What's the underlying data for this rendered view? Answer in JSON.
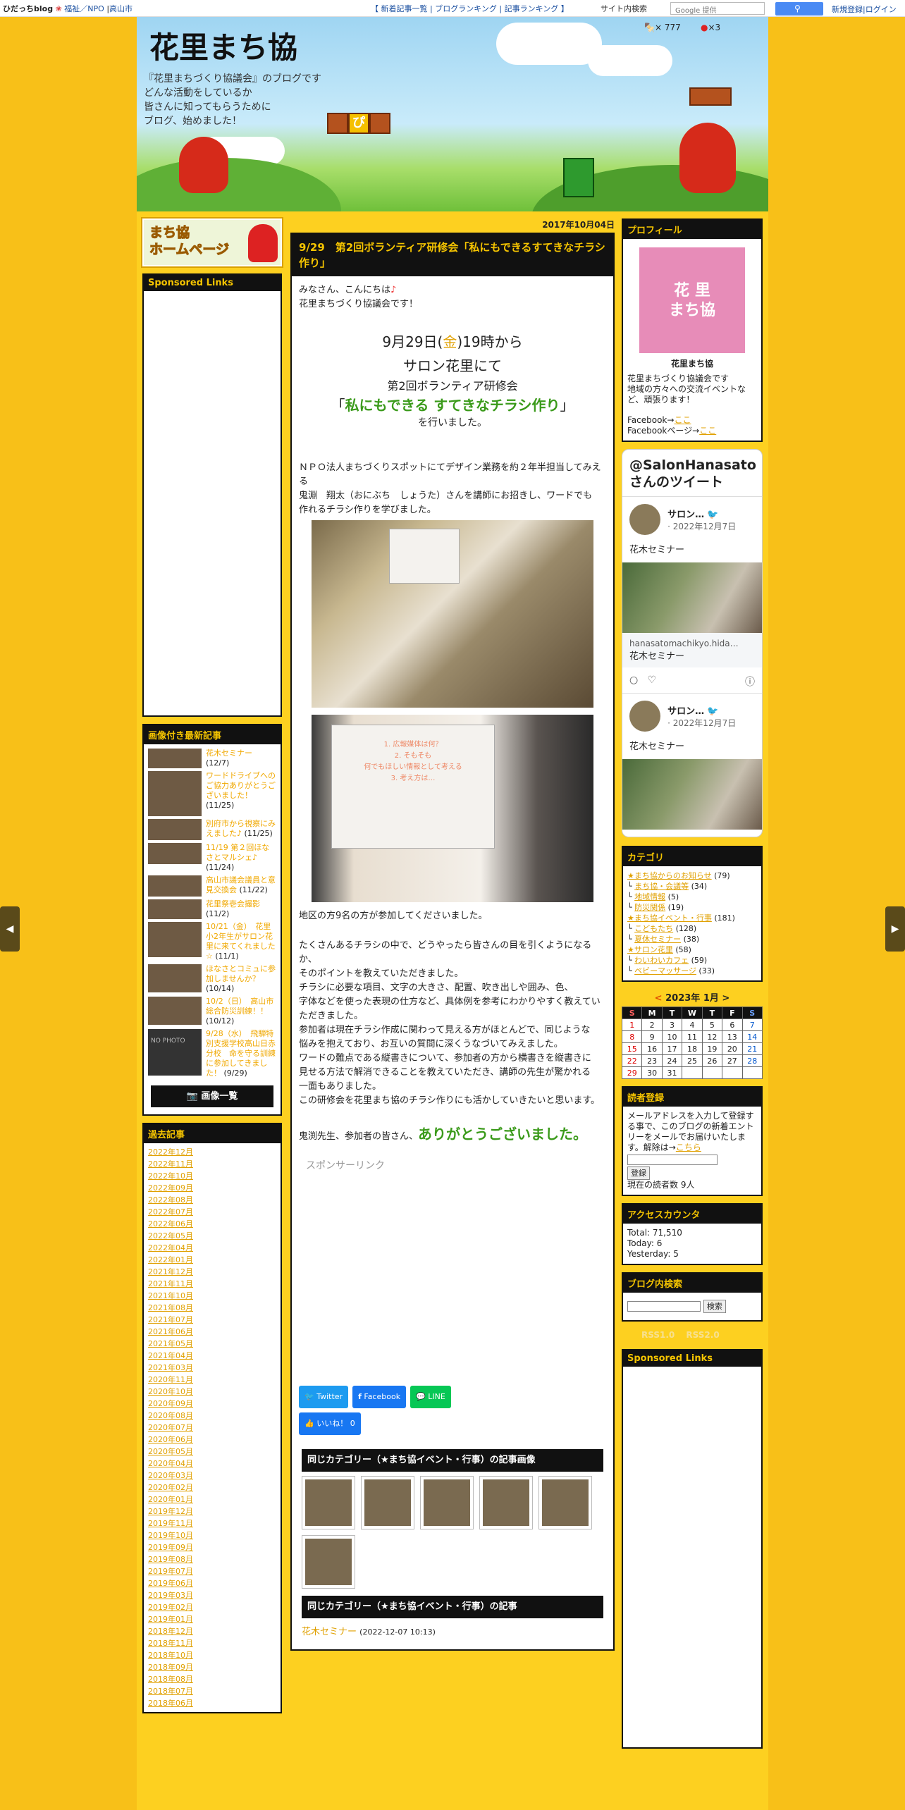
{
  "topbar": {
    "brand": "ひだっちblog",
    "cat1": "福祉／NPO",
    "cat2": "高山市",
    "links": [
      "新着記事一覧",
      "ブログランキング",
      "記事ランキング"
    ],
    "site_search": "サイト内検索",
    "google_placeholder": "Google 提供",
    "account": "新規登録|ログイン"
  },
  "header": {
    "title": "花里まち協",
    "desc": [
      "『花里まちづくり協議会』のブログです",
      "どんな活動をしているか",
      "皆さんに知ってもらうために",
      "ブログ、始めました！"
    ],
    "count1": "× 777",
    "count2": "×3",
    "block_letter": "ぴ"
  },
  "left": {
    "banner": [
      "まち協",
      "ホームページ"
    ],
    "sponsored_title": "Sponsored Links",
    "recent_title": "画像付き最新記事",
    "recent": [
      {
        "title": "花木セミナー",
        "date": "(12/7)"
      },
      {
        "title": "ワードドライブへのご協力ありがとうございました！",
        "date": "(11/25)"
      },
      {
        "title": "別府市から視察にみえました♪",
        "date": "(11/25)"
      },
      {
        "title": "11/19 第２回ほなさとマルシェ♪",
        "date": "(11/24)"
      },
      {
        "title": "高山市議会議員と意見交換会",
        "date": "(11/22)"
      },
      {
        "title": "花里祭壱会撮影",
        "date": "(11/2)"
      },
      {
        "title": "10/21（金）　花里小2年生がサロン花里に来てくれました☆",
        "date": "(11/1)"
      },
      {
        "title": "ほなさとコミュに参加しませんか？",
        "date": "(10/14)"
      },
      {
        "title": "10/2（日）　高山市総合防災訓練！！",
        "date": "(10/12)"
      },
      {
        "title": "9/28（水）　飛騨特別支援学校高山日赤分校　命を守る訓練に参加してきました！",
        "date": "(9/29)"
      }
    ],
    "no_photo": "NO PHOTO",
    "gallery_btn": "📷 画像一覧",
    "archive_title": "過去記事",
    "archive": [
      "2022年12月",
      "2022年11月",
      "2022年10月",
      "2022年09月",
      "2022年08月",
      "2022年07月",
      "2022年06月",
      "2022年05月",
      "2022年04月",
      "2022年01月",
      "2021年12月",
      "2021年11月",
      "2021年10月",
      "2021年08月",
      "2021年07月",
      "2021年06月",
      "2021年05月",
      "2021年04月",
      "2021年03月",
      "2020年11月",
      "2020年10月",
      "2020年09月",
      "2020年08月",
      "2020年07月",
      "2020年06月",
      "2020年05月",
      "2020年04月",
      "2020年03月",
      "2020年02月",
      "2020年01月",
      "2019年12月",
      "2019年11月",
      "2019年10月",
      "2019年09月",
      "2019年08月",
      "2019年07月",
      "2019年06月",
      "2019年03月",
      "2019年02月",
      "2019年01月",
      "2018年12月",
      "2018年11月",
      "2018年10月",
      "2018年09月",
      "2018年08月",
      "2018年07月",
      "2018年06月"
    ]
  },
  "post": {
    "date": "2017年10月04日",
    "title": "9/29　第2回ボランティア研修会「私にもできるすてきなチラシ作り」",
    "intro": [
      "みなさん、こんにちは",
      "花里まちづくり協議会です！"
    ],
    "heart": "♪",
    "when_pre": "9月29日(",
    "when_day": "金",
    "when_post": ")19時から",
    "where": "サロン花里にて",
    "event": "第2回ボランティア研修会",
    "theme_open": "「",
    "theme": "私にもできる すてきなチラシ作り",
    "theme_close": "」",
    "done": "を行いました。",
    "p1": [
      "ＮＰＯ法人まちづくりスポットにてデザイン業務を約２年半担当してみえる",
      "鬼淵　翔太（おにぶち　しょうた）さんを講師にお招きし、ワードでも",
      "作れるチラシ作りを学びました。"
    ],
    "slide_lines": [
      "1. 広報媒体は何？",
      "2. そもそも",
      "何でもほしい情報として考える",
      "3. 考え方は…"
    ],
    "attend": "地区の方9名の方が参加してくださいました。",
    "p2": [
      "たくさんあるチラシの中で、どうやったら皆さんの目を引くようになるか、",
      "そのポイントを教えていただきました。",
      "チラシに必要な項目、文字の大きさ、配置、吹き出しや囲み、色、",
      "字体などを使った表現の仕方など、具体例を参考にわかりやすく教えていただきました。",
      "参加者は現在チラシ作成に関わって見える方がほとんどで、同じような",
      "悩みを抱えており、お互いの質問に深くうなづいてみえました。",
      "ワードの難点である縦書きについて、参加者の方から横書きを縦書きに",
      "見せる方法で解消できることを教えていただき、講師の先生が驚かれる",
      "一面もありました。",
      "この研修会を花里まち協のチラシ作りにも活かしていきたいと思います。"
    ],
    "thanks_pre": "鬼渕先生、参加者の皆さん、",
    "thanks": "ありがとうございました。",
    "sponsor": "スポンサーリンク",
    "share": {
      "twitter": "Twitter",
      "facebook": "Facebook",
      "line": "LINE",
      "like": "いいね！ 0"
    },
    "same_cat_images_title": "同じカテゴリー（★まち協イベント・行事）の記事画像",
    "same_cat_title": "同じカテゴリー（★まち協イベント・行事）の記事",
    "same_cat_first": {
      "title": "花木セミナー",
      "date": "(2022-12-07 10:13)"
    }
  },
  "right": {
    "profile_title": "プロフィール",
    "logo": [
      "花 里",
      "まち協"
    ],
    "name": "花里まち協",
    "profile_text": [
      "花里まちづくり協議会です",
      "地域の方々への交流イベントなど、頑張ります！"
    ],
    "fb1_pre": "Facebook→",
    "fb1_link": "ここ",
    "fb2_pre": "Facebookページ→",
    "fb2_link": "ここ",
    "twitter_title": "@SalonHanasato さんのツイート",
    "tweets": [
      {
        "name": "サロン…",
        "date": "· 2022年12月7日",
        "text": "花木セミナー",
        "link": "hanasatomachikyo.hida…",
        "card": "花木セミナー"
      },
      {
        "name": "サロン…",
        "date": "· 2022年12月7日",
        "text": "花木セミナー"
      }
    ],
    "cat_title": "カテゴリ",
    "cats": [
      {
        "n": "★まち協からのお知らせ",
        "c": "(79)"
      },
      {
        "n": "まち協・会議等",
        "c": "(34)"
      },
      {
        "n": "地域情報",
        "c": "(5)"
      },
      {
        "n": "防災関係",
        "c": "(19)"
      },
      {
        "n": "★まち協イベント・行事",
        "c": "(181)"
      },
      {
        "n": "こどもたち",
        "c": "(128)"
      },
      {
        "n": "夏休セミナー",
        "c": "(38)"
      },
      {
        "n": "★サロン花里",
        "c": "(58)"
      },
      {
        "n": "わいわいカフェ",
        "c": "(59)"
      },
      {
        "n": "ベビーマッサージ",
        "c": "(33)"
      }
    ],
    "cal_title": "2023年 1月",
    "cal_prev": "<",
    "cal_next": ">",
    "cal_head": [
      "S",
      "M",
      "T",
      "W",
      "T",
      "F",
      "S"
    ],
    "cal_weeks": [
      [
        "1",
        "2",
        "3",
        "4",
        "5",
        "6",
        "7"
      ],
      [
        "8",
        "9",
        "10",
        "11",
        "12",
        "13",
        "14"
      ],
      [
        "15",
        "16",
        "17",
        "18",
        "19",
        "20",
        "21"
      ],
      [
        "22",
        "23",
        "24",
        "25",
        "26",
        "27",
        "28"
      ],
      [
        "29",
        "30",
        "31",
        "",
        "",
        "",
        ""
      ]
    ],
    "reader_title": "読者登録",
    "reader_text": "メールアドレスを入力して登録する事で、このブログの新着エントリーをメールでお届けいたします。解除は→",
    "reader_link": "こちら",
    "reader_btn": "登録",
    "reader_count": "現在の読者数 9人",
    "access_title": "アクセスカウンタ",
    "access": [
      "Total: 71,510",
      "Today: 6",
      "Yesterday: 5"
    ],
    "search_title": "ブログ内検索",
    "search_btn": "検索",
    "rss": "RSS1.0 　RSS2.0",
    "sponsored_title": "Sponsored Links"
  }
}
